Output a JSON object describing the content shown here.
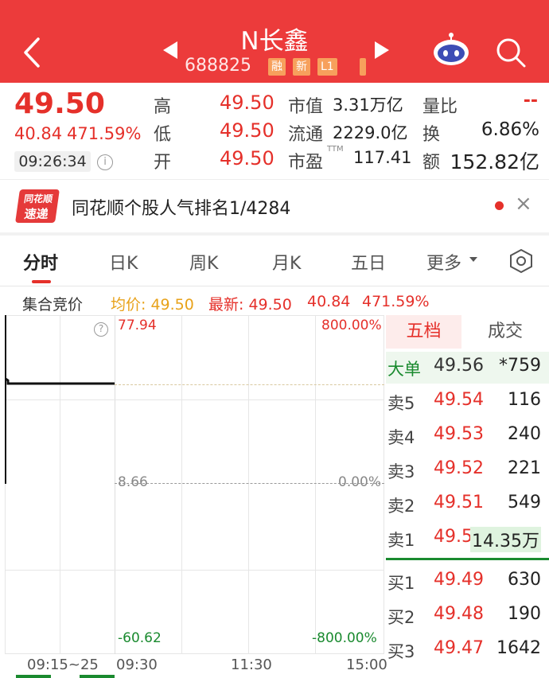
{
  "header": {
    "title": "N长鑫",
    "code": "688825",
    "tags": [
      "融",
      "新",
      "L1"
    ],
    "back_icon": "chevron-left-icon",
    "prev_icon": "triangle-left-icon",
    "next_icon": "triangle-right-icon",
    "robot_icon": "robot-assistant-icon",
    "search_icon": "search-icon"
  },
  "quote": {
    "price": "49.50",
    "change": "40.84",
    "change_pct": "471.59%",
    "time": "09:26:34",
    "stats": [
      {
        "label": "高",
        "value": "49.50"
      },
      {
        "label": "低",
        "value": "49.50"
      },
      {
        "label": "开",
        "value": "49.50"
      }
    ],
    "market": [
      {
        "label": "市值",
        "value": "3.31万亿"
      },
      {
        "label": "流通",
        "value": "2229.0亿"
      },
      {
        "label": "市盈",
        "sup": "TTM",
        "value": "117.41"
      }
    ],
    "extra": [
      {
        "label": "量比",
        "value": "--"
      },
      {
        "label": "换",
        "value": "6.86%"
      },
      {
        "label": "额",
        "value": "152.82亿"
      }
    ]
  },
  "news": {
    "logo_top": "同花顺",
    "logo_bottom": "速递",
    "text": "同花顺个股人气排名1/4284"
  },
  "tabs": [
    "分时",
    "日K",
    "周K",
    "月K",
    "五日",
    "更多"
  ],
  "info_line": {
    "label": "集合竞价",
    "avg": "均价: 49.50",
    "latest": "最新: 49.50",
    "change": "40.84",
    "change_pct": "471.59%"
  },
  "chart": {
    "y_top": "77.94",
    "y_mid": "8.66",
    "y_bottom": "-60.62",
    "pct_top": "800.00%",
    "pct_mid": "0.00%",
    "pct_bottom": "-800.00%",
    "x_labels": [
      "09:15~25",
      "09:30",
      "11:30",
      "15:00"
    ]
  },
  "orderbook": {
    "tab_active": "五档",
    "tab_other": "成交",
    "big": {
      "label": "大单",
      "price": "49.56",
      "vol": "*759"
    },
    "sells": [
      {
        "label": "卖5",
        "price": "49.54",
        "vol": "116"
      },
      {
        "label": "卖4",
        "price": "49.53",
        "vol": "240"
      },
      {
        "label": "卖3",
        "price": "49.52",
        "vol": "221"
      },
      {
        "label": "卖2",
        "price": "49.51",
        "vol": "549"
      },
      {
        "label": "卖1",
        "price": "49.50",
        "vol": "14.35万"
      }
    ],
    "buys": [
      {
        "label": "买1",
        "price": "49.49",
        "vol": "630"
      },
      {
        "label": "买2",
        "price": "49.48",
        "vol": "190"
      },
      {
        "label": "买3",
        "price": "49.47",
        "vol": "1642"
      }
    ]
  }
}
